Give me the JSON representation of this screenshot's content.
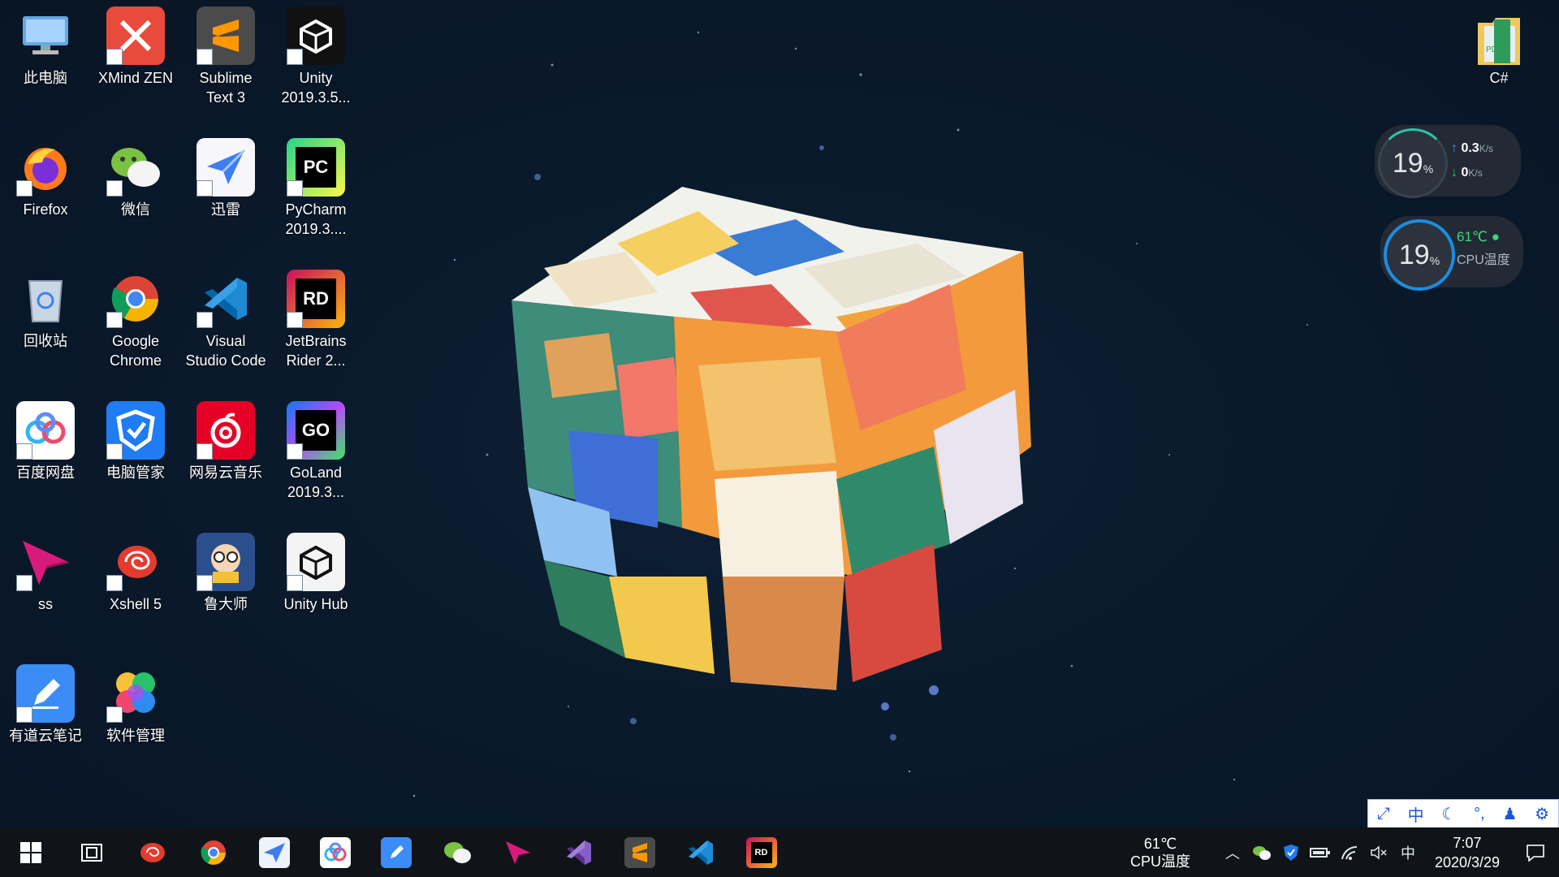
{
  "desktop": {
    "icons": [
      {
        "label": "此电脑",
        "icon": "computer-icon"
      },
      {
        "label": "XMind ZEN",
        "icon": "xmind-icon"
      },
      {
        "label": "Sublime\nText 3",
        "icon": "sublime-icon"
      },
      {
        "label": "Unity\n2019.3.5...",
        "icon": "unity-icon"
      },
      {
        "label": "Firefox",
        "icon": "firefox-icon"
      },
      {
        "label": "微信",
        "icon": "wechat-icon"
      },
      {
        "label": "迅雷",
        "icon": "xunlei-icon"
      },
      {
        "label": "PyCharm\n2019.3....",
        "icon": "pycharm-icon"
      },
      {
        "label": "回收站",
        "icon": "recycle-bin-icon"
      },
      {
        "label": "Google\nChrome",
        "icon": "chrome-icon"
      },
      {
        "label": "Visual\nStudio Code",
        "icon": "vscode-icon"
      },
      {
        "label": "JetBrains\nRider 2...",
        "icon": "rider-icon"
      },
      {
        "label": "百度网盘",
        "icon": "baidu-netdisk-icon"
      },
      {
        "label": "电脑管家",
        "icon": "pc-manager-icon"
      },
      {
        "label": "网易云音乐",
        "icon": "netease-music-icon"
      },
      {
        "label": "GoLand\n2019.3...",
        "icon": "goland-icon"
      },
      {
        "label": "ss",
        "icon": "ss-icon"
      },
      {
        "label": "Xshell 5",
        "icon": "xshell-icon"
      },
      {
        "label": "鲁大师",
        "icon": "ludashi-icon"
      },
      {
        "label": "Unity Hub",
        "icon": "unity-hub-icon"
      },
      {
        "label": "有道云笔记",
        "icon": "youdao-note-icon"
      },
      {
        "label": "软件管理",
        "icon": "software-manager-icon"
      }
    ],
    "file_right": {
      "label": "C#",
      "icon": "pdf-archive-icon"
    }
  },
  "widgets": {
    "net": {
      "percent": "19",
      "unit": "%",
      "up": "0.3",
      "up_unit": "K/s",
      "down": "0",
      "down_unit": "K/s"
    },
    "cpu": {
      "percent": "19",
      "unit": "%",
      "temp": "61℃",
      "label": "CPU温度"
    }
  },
  "ime_panel": {
    "items": [
      "中"
    ]
  },
  "taskbar": {
    "apps": [
      "start-icon",
      "task-view-icon",
      "xshell-icon",
      "chrome-icon",
      "xunlei-icon",
      "baidu-netdisk-icon",
      "youdao-note-icon",
      "wechat-icon",
      "ss-icon",
      "visual-studio-icon",
      "sublime-icon",
      "vscode-icon",
      "rider-icon"
    ],
    "cpu_temp_value": "61℃",
    "cpu_temp_label": "CPU温度",
    "ime": "中",
    "time": "7:07",
    "date": "2020/3/29"
  },
  "colors": {
    "taskbar": "#101418",
    "desktop": "#0a1a2c",
    "accent": "#1a56db"
  }
}
